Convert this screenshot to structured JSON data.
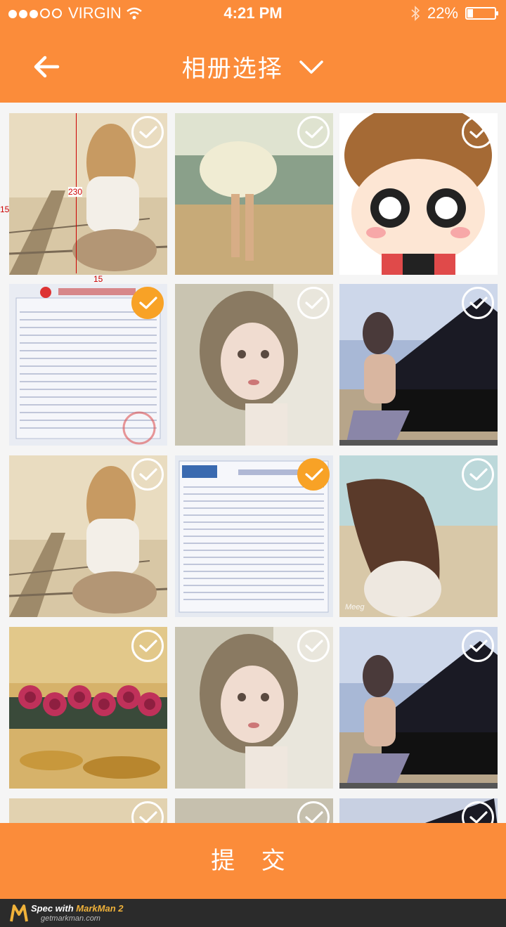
{
  "status_bar": {
    "carrier": "VIRGIN",
    "time": "4:21 PM",
    "battery": "22%",
    "battery_level": 0.22,
    "signal_dots": [
      true,
      true,
      true,
      false,
      false
    ]
  },
  "navbar": {
    "title": "相册选择"
  },
  "annotations": {
    "height": "230",
    "margin_left": "15",
    "margin_bottom": "15"
  },
  "photos": [
    {
      "name": "girl-on-railway",
      "selected": false
    },
    {
      "name": "girl-in-white-skirt-beach",
      "selected": false
    },
    {
      "name": "cartoon-girl",
      "selected": false
    },
    {
      "name": "insurance-document",
      "selected": true
    },
    {
      "name": "girl-portrait",
      "selected": false
    },
    {
      "name": "girl-at-piano",
      "selected": false
    },
    {
      "name": "girl-on-railway",
      "selected": false
    },
    {
      "name": "cpic-insurance-document",
      "selected": true
    },
    {
      "name": "girl-hair-windblown",
      "selected": false,
      "caption": "Meeg"
    },
    {
      "name": "roses-on-leaves",
      "selected": false
    },
    {
      "name": "girl-portrait",
      "selected": false
    },
    {
      "name": "girl-at-piano",
      "selected": false
    },
    {
      "name": "partial-1",
      "selected": false
    },
    {
      "name": "partial-2",
      "selected": false
    },
    {
      "name": "partial-3",
      "selected": false
    }
  ],
  "submit": {
    "label": "提 交"
  },
  "footer": {
    "spec_with": "Spec with ",
    "brand": "MarkMan 2",
    "url": "getmarkman.com"
  },
  "colors": {
    "accent": "#fb8c3a",
    "selected": "#f8a226"
  }
}
